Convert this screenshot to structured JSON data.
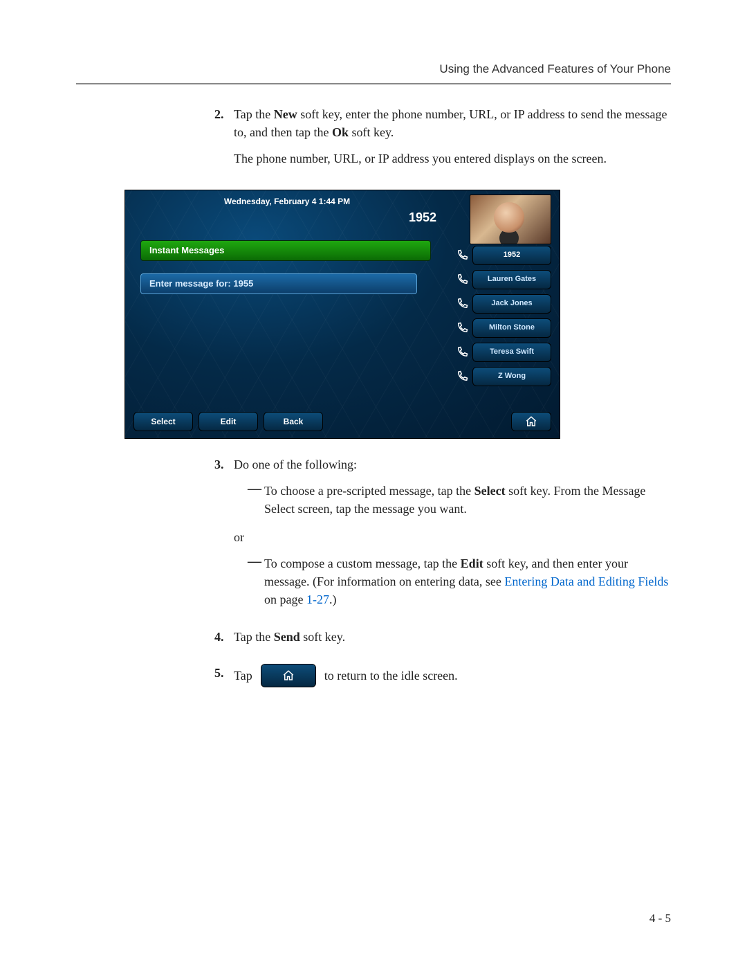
{
  "header": "Using the Advanced Features of Your Phone",
  "steps": {
    "s2": {
      "num": "2.",
      "line1a": "Tap the ",
      "line1b": "New",
      "line1c": " soft key, enter the phone number, URL, or IP address to send the message to, and then tap the ",
      "line1d": "Ok",
      "line1e": " soft key.",
      "line2": "The phone number, URL, or IP address you entered displays on the screen."
    },
    "s3": {
      "num": "3.",
      "intro": "Do one of the following:",
      "a1": "To choose a pre-scripted message, tap the ",
      "a2": "Select",
      "a3": " soft key. From the Message Select screen, tap the message you want.",
      "or": "or",
      "b1": "To compose a custom message, tap the ",
      "b2": "Edit",
      "b3": " soft key, and then enter your message. (For information on entering data, see ",
      "b4": "Entering Data and Editing Fields",
      "b5": " on page ",
      "b6": "1-27",
      "b7": ".)"
    },
    "s4": {
      "num": "4.",
      "t1": "Tap the ",
      "t2": "Send",
      "t3": " soft key."
    },
    "s5": {
      "num": "5.",
      "pre": "Tap",
      "post": "to return to the idle screen."
    }
  },
  "phone": {
    "datetime": "Wednesday, February 4  1:44 PM",
    "extension": "1952",
    "im_header": "Instant Messages",
    "im_prompt": "Enter message for: 1955",
    "contacts": [
      "1952",
      "Lauren Gates",
      "Jack Jones",
      "Milton Stone",
      "Teresa Swift",
      "Z Wong"
    ],
    "softkeys": [
      "Select",
      "Edit",
      "Back"
    ]
  },
  "footer": "4 - 5"
}
